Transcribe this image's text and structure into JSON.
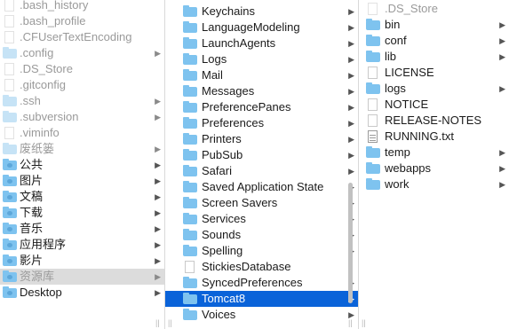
{
  "column1": {
    "items": [
      {
        "label": ".bash_history",
        "icon": "document-icon",
        "dim": true
      },
      {
        "label": ".bash_profile",
        "icon": "document-icon",
        "dim": true
      },
      {
        "label": ".CFUserTextEncoding",
        "icon": "document-icon",
        "dim": true
      },
      {
        "label": ".config",
        "icon": "folder-icon",
        "dim": true,
        "arrow": true
      },
      {
        "label": ".DS_Store",
        "icon": "document-icon",
        "dim": true
      },
      {
        "label": ".gitconfig",
        "icon": "document-icon",
        "dim": true
      },
      {
        "label": ".ssh",
        "icon": "folder-icon",
        "dim": true,
        "arrow": true
      },
      {
        "label": ".subversion",
        "icon": "folder-icon",
        "dim": true,
        "arrow": true
      },
      {
        "label": ".viminfo",
        "icon": "document-icon",
        "dim": true
      },
      {
        "label": "废纸篓",
        "icon": "folder-icon",
        "dim": true,
        "arrow": true
      },
      {
        "label": "公共",
        "icon": "public-folder-icon",
        "arrow": true
      },
      {
        "label": "图片",
        "icon": "pictures-folder-icon",
        "arrow": true
      },
      {
        "label": "文稿",
        "icon": "documents-folder-icon",
        "arrow": true
      },
      {
        "label": "下载",
        "icon": "downloads-folder-icon",
        "arrow": true
      },
      {
        "label": "音乐",
        "icon": "music-folder-icon",
        "arrow": true
      },
      {
        "label": "应用程序",
        "icon": "applications-folder-icon",
        "arrow": true
      },
      {
        "label": "影片",
        "icon": "movies-folder-icon",
        "arrow": true
      },
      {
        "label": "资源库",
        "icon": "library-folder-icon",
        "arrow": true,
        "dim": true,
        "inactive_selected": true
      },
      {
        "label": "Desktop",
        "icon": "desktop-folder-icon",
        "arrow": true
      }
    ]
  },
  "column2": {
    "items": [
      {
        "label": "Keychains",
        "icon": "folder-icon",
        "arrow": true
      },
      {
        "label": "LanguageModeling",
        "icon": "folder-icon",
        "arrow": true
      },
      {
        "label": "LaunchAgents",
        "icon": "folder-icon",
        "arrow": true
      },
      {
        "label": "Logs",
        "icon": "folder-icon",
        "arrow": true
      },
      {
        "label": "Mail",
        "icon": "folder-icon",
        "arrow": true
      },
      {
        "label": "Messages",
        "icon": "folder-icon",
        "arrow": true
      },
      {
        "label": "PreferencePanes",
        "icon": "folder-icon",
        "arrow": true
      },
      {
        "label": "Preferences",
        "icon": "folder-icon",
        "arrow": true
      },
      {
        "label": "Printers",
        "icon": "folder-icon",
        "arrow": true
      },
      {
        "label": "PubSub",
        "icon": "folder-icon",
        "arrow": true
      },
      {
        "label": "Safari",
        "icon": "folder-icon",
        "arrow": true
      },
      {
        "label": "Saved Application State",
        "icon": "folder-icon",
        "arrow": true
      },
      {
        "label": "Screen Savers",
        "icon": "folder-icon",
        "arrow": true
      },
      {
        "label": "Services",
        "icon": "folder-icon",
        "arrow": true
      },
      {
        "label": "Sounds",
        "icon": "folder-icon",
        "arrow": true
      },
      {
        "label": "Spelling",
        "icon": "folder-icon",
        "arrow": true
      },
      {
        "label": "StickiesDatabase",
        "icon": "document-icon"
      },
      {
        "label": "SyncedPreferences",
        "icon": "folder-icon",
        "arrow": true
      },
      {
        "label": "Tomcat8",
        "icon": "folder-icon",
        "arrow": true,
        "selected": true
      },
      {
        "label": "Voices",
        "icon": "folder-icon",
        "arrow": true
      }
    ]
  },
  "column3": {
    "items": [
      {
        "label": ".DS_Store",
        "icon": "document-icon",
        "dim": true
      },
      {
        "label": "bin",
        "icon": "folder-icon",
        "arrow": true
      },
      {
        "label": "conf",
        "icon": "folder-icon",
        "arrow": true
      },
      {
        "label": "lib",
        "icon": "folder-icon",
        "arrow": true
      },
      {
        "label": "LICENSE",
        "icon": "document-icon"
      },
      {
        "label": "logs",
        "icon": "folder-icon",
        "arrow": true
      },
      {
        "label": "NOTICE",
        "icon": "document-icon"
      },
      {
        "label": "RELEASE-NOTES",
        "icon": "document-icon"
      },
      {
        "label": "RUNNING.txt",
        "icon": "text-document-icon"
      },
      {
        "label": "temp",
        "icon": "folder-icon",
        "arrow": true
      },
      {
        "label": "webapps",
        "icon": "folder-icon",
        "arrow": true
      },
      {
        "label": "work",
        "icon": "folder-icon",
        "arrow": true
      }
    ]
  },
  "glyphs": {
    "arrow": "▶",
    "resize": "||"
  },
  "colors": {
    "selection": "#0a63d9",
    "folder": "#7ec3ef",
    "inactive_selection": "#dcdcdc"
  }
}
